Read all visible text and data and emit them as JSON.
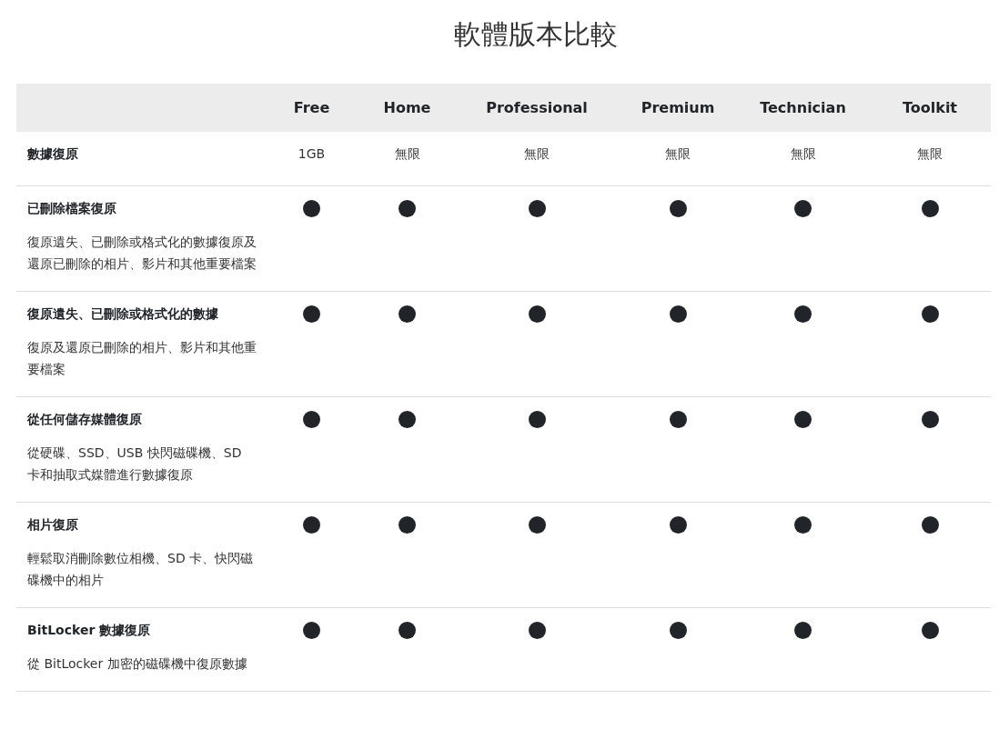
{
  "title": "軟體版本比較",
  "columns": [
    "Free",
    "Home",
    "Professional",
    "Premium",
    "Technician",
    "Toolkit"
  ],
  "rows": [
    {
      "title": "數據復原",
      "cells": [
        {
          "kind": "text",
          "text": "1GB"
        },
        {
          "kind": "text",
          "text": "無限"
        },
        {
          "kind": "text",
          "text": "無限"
        },
        {
          "kind": "text",
          "text": "無限"
        },
        {
          "kind": "text",
          "text": "無限"
        },
        {
          "kind": "text",
          "text": "無限"
        }
      ]
    },
    {
      "title": "已刪除檔案復原",
      "description": "復原遺失、已刪除或格式化的數據復原及還原已刪除的相片、影片和其他重要檔案",
      "cells": [
        {
          "kind": "dot",
          "included": true
        },
        {
          "kind": "dot",
          "included": true
        },
        {
          "kind": "dot",
          "included": true
        },
        {
          "kind": "dot",
          "included": true
        },
        {
          "kind": "dot",
          "included": true
        },
        {
          "kind": "dot",
          "included": true
        }
      ]
    },
    {
      "title": "復原遺失、已刪除或格式化的數據",
      "description": "復原及還原已刪除的相片、影片和其他重要檔案",
      "cells": [
        {
          "kind": "dot",
          "included": true
        },
        {
          "kind": "dot",
          "included": true
        },
        {
          "kind": "dot",
          "included": true
        },
        {
          "kind": "dot",
          "included": true
        },
        {
          "kind": "dot",
          "included": true
        },
        {
          "kind": "dot",
          "included": true
        }
      ]
    },
    {
      "title": "從任何儲存媒體復原",
      "description": "從硬碟、SSD、USB 快閃磁碟機、SD 卡和抽取式媒體進行數據復原",
      "cells": [
        {
          "kind": "dot",
          "included": true
        },
        {
          "kind": "dot",
          "included": true
        },
        {
          "kind": "dot",
          "included": true
        },
        {
          "kind": "dot",
          "included": true
        },
        {
          "kind": "dot",
          "included": true
        },
        {
          "kind": "dot",
          "included": true
        }
      ]
    },
    {
      "title": "相片復原",
      "description": "輕鬆取消刪除數位相機、SD 卡、快閃磁碟機中的相片",
      "cells": [
        {
          "kind": "dot",
          "included": true
        },
        {
          "kind": "dot",
          "included": true
        },
        {
          "kind": "dot",
          "included": true
        },
        {
          "kind": "dot",
          "included": true
        },
        {
          "kind": "dot",
          "included": true
        },
        {
          "kind": "dot",
          "included": true
        }
      ]
    },
    {
      "title": "BitLocker 數據復原",
      "description": "從 BitLocker 加密的磁碟機中復原數據",
      "cells": [
        {
          "kind": "dot",
          "included": true
        },
        {
          "kind": "dot",
          "included": true
        },
        {
          "kind": "dot",
          "included": true
        },
        {
          "kind": "dot",
          "included": true
        },
        {
          "kind": "dot",
          "included": true
        },
        {
          "kind": "dot",
          "included": true
        }
      ]
    }
  ]
}
